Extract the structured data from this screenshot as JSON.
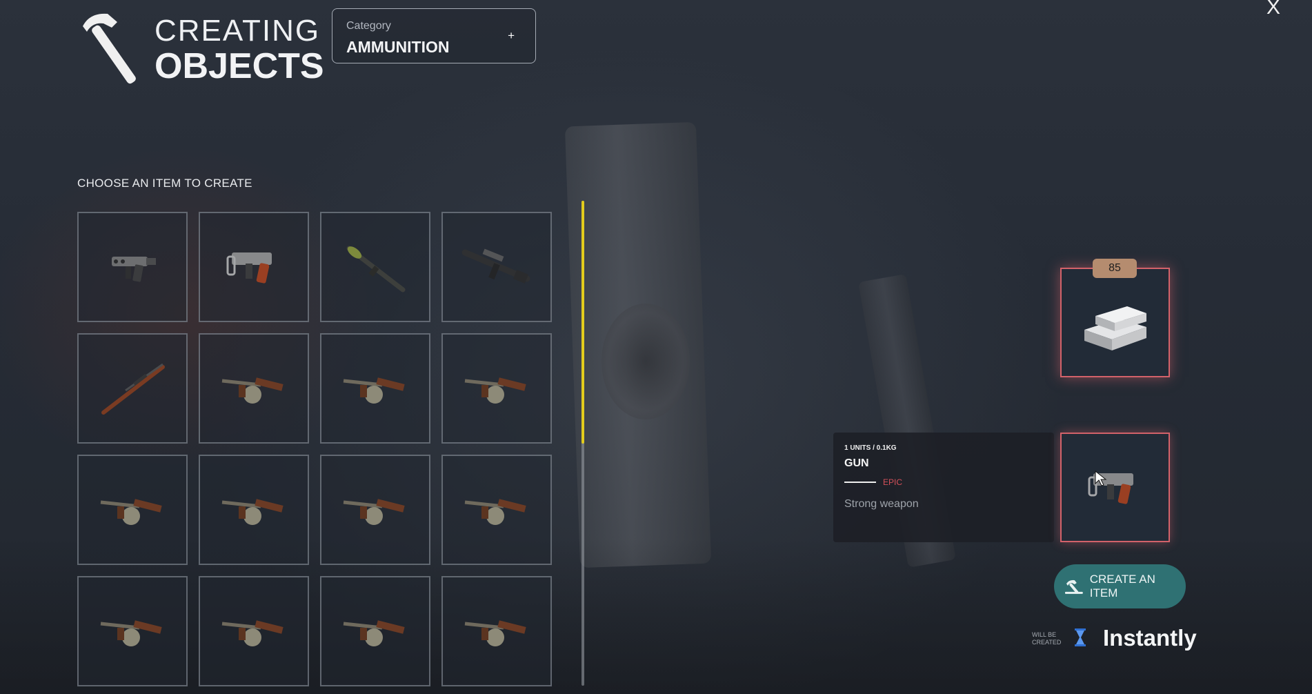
{
  "header": {
    "title_line1": "CREATING",
    "title_line2": "OBJECTS",
    "category_label": "Category",
    "category_value": "AMMUNITION",
    "category_plus": "+",
    "close_label": "X"
  },
  "grid": {
    "heading": "CHOOSE AN ITEM TO CREATE",
    "items": [
      {
        "icon": "machine-pistol-icon"
      },
      {
        "icon": "compact-smg-icon"
      },
      {
        "icon": "rpg-launcher-icon"
      },
      {
        "icon": "assault-rifle-icon"
      },
      {
        "icon": "sniper-rifle-icon"
      },
      {
        "icon": "tommy-gun-icon"
      },
      {
        "icon": "tommy-gun-icon"
      },
      {
        "icon": "tommy-gun-icon"
      },
      {
        "icon": "tommy-gun-icon"
      },
      {
        "icon": "tommy-gun-icon"
      },
      {
        "icon": "tommy-gun-icon"
      },
      {
        "icon": "tommy-gun-icon"
      },
      {
        "icon": "tommy-gun-icon"
      },
      {
        "icon": "tommy-gun-icon"
      },
      {
        "icon": "tommy-gun-icon"
      },
      {
        "icon": "tommy-gun-icon"
      }
    ]
  },
  "scroll": {
    "visible_fraction": 0.5
  },
  "ingredient": {
    "count": "85",
    "icon": "silver-ingots-icon"
  },
  "selected_item": {
    "units": "1 UNITS / 0.1KG",
    "name": "GUN",
    "rarity": "EPIC",
    "description": "Strong weapon",
    "icon": "compact-smg-icon"
  },
  "actions": {
    "create_label": "CREATE AN ITEM",
    "will_be_line1": "WILL BE",
    "will_be_line2": "CREATED",
    "time_value": "Instantly"
  },
  "colors": {
    "accent_yellow": "#e3cc1c",
    "slot_border_red": "#d3626a",
    "rarity_epic": "#d3505a",
    "button_teal": "#2f7173",
    "count_badge": "#b58c6f"
  }
}
